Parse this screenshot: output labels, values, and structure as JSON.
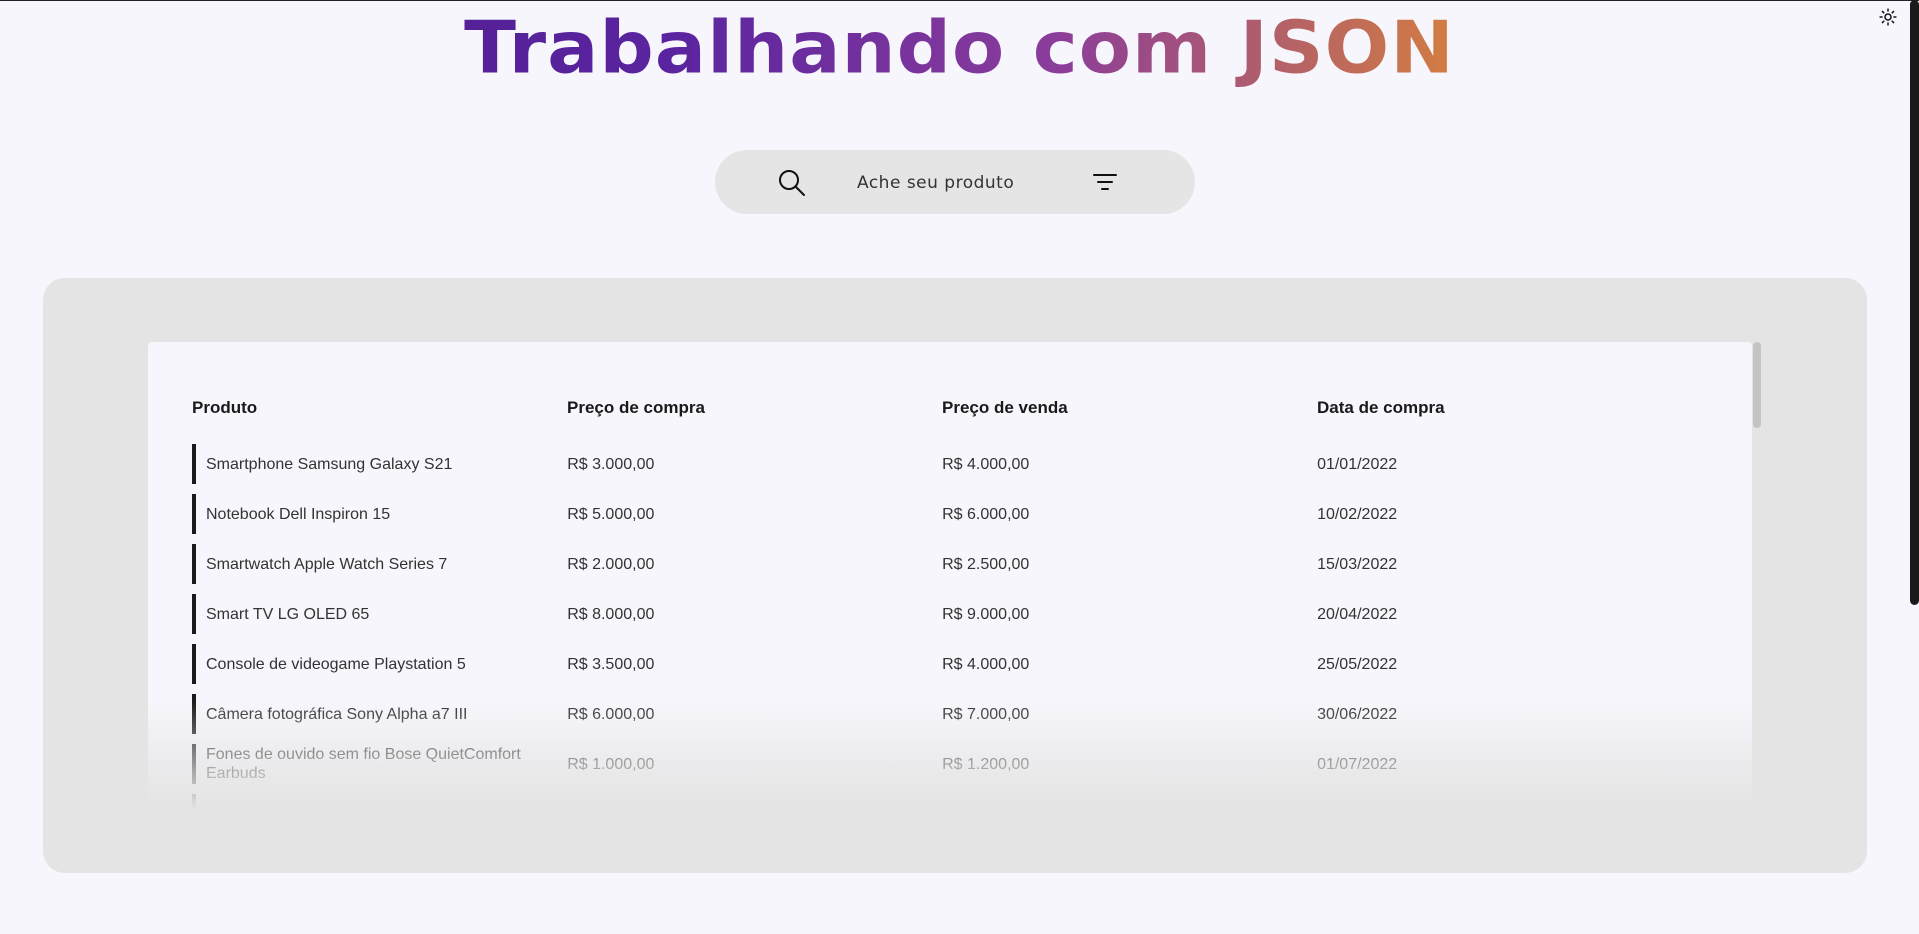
{
  "header": {
    "title": "Trabalhando com JSON"
  },
  "theme_toggle": {
    "icon": "sun-icon"
  },
  "search": {
    "placeholder": "Ache seu produto",
    "icon": "search-icon",
    "filter_icon": "filter-icon"
  },
  "table": {
    "columns": [
      "Produto",
      "Preço de compra",
      "Preço de venda",
      "Data de compra"
    ],
    "rows": [
      {
        "produto": "Smartphone Samsung Galaxy S21",
        "compra": "R$ 3.000,00",
        "venda": "R$ 4.000,00",
        "data": "01/01/2022"
      },
      {
        "produto": "Notebook Dell Inspiron 15",
        "compra": "R$ 5.000,00",
        "venda": "R$ 6.000,00",
        "data": "10/02/2022"
      },
      {
        "produto": "Smartwatch Apple Watch Series 7",
        "compra": "R$ 2.000,00",
        "venda": "R$ 2.500,00",
        "data": "15/03/2022"
      },
      {
        "produto": "Smart TV LG OLED 65",
        "compra": "R$ 8.000,00",
        "venda": "R$ 9.000,00",
        "data": "20/04/2022"
      },
      {
        "produto": "Console de videogame Playstation 5",
        "compra": "R$ 3.500,00",
        "venda": "R$ 4.000,00",
        "data": "25/05/2022"
      },
      {
        "produto": "Câmera fotográfica Sony Alpha a7 III",
        "compra": "R$ 6.000,00",
        "venda": "R$ 7.000,00",
        "data": "30/06/2022"
      },
      {
        "produto": "Fones de ouvido sem fio Bose QuietComfort Earbuds",
        "compra": "R$ 1.000,00",
        "venda": "R$ 1.200,00",
        "data": "01/07/2022"
      }
    ]
  }
}
